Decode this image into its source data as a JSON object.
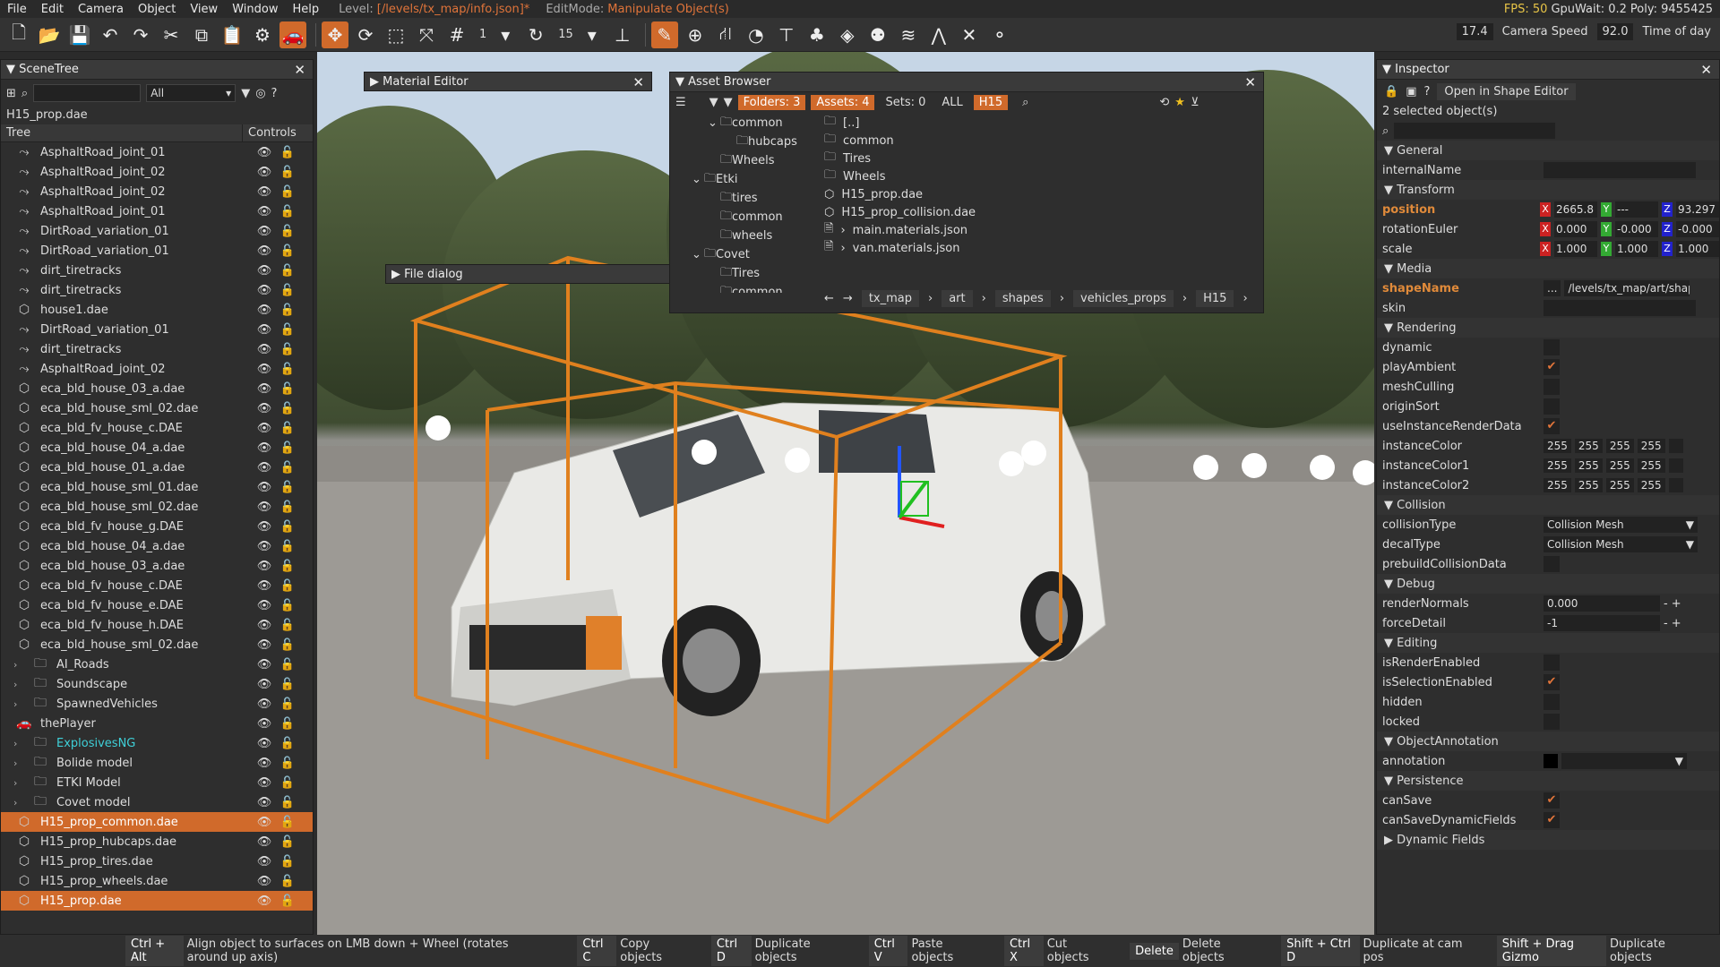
{
  "menu": {
    "items": [
      "File",
      "Edit",
      "Camera",
      "Object",
      "View",
      "Window",
      "Help"
    ],
    "level_label": "Level:",
    "level_value": "[/levels/tx_map/info.json]*",
    "editmode_label": "EditMode:",
    "editmode_value": "Manipulate Object(s)",
    "fps": "FPS: 50",
    "gpuwait": "GpuWait: 0.2",
    "poly": "Poly: 9455425"
  },
  "toolbar": {
    "snap_value": "1",
    "rot_value": "15",
    "fov_value": "17.4",
    "camera_speed_label": "Camera Speed",
    "camera_speed_value": "92.0",
    "time_of_day_label": "Time of day"
  },
  "scenetree": {
    "title": "SceneTree",
    "filter": "All",
    "file": "H15_prop.dae",
    "col_tree": "Tree",
    "col_controls": "Controls",
    "items": [
      {
        "label": "AsphaltRoad_joint_01",
        "icon": "road-icon",
        "sel": false
      },
      {
        "label": "AsphaltRoad_joint_02",
        "icon": "road-icon",
        "sel": false
      },
      {
        "label": "AsphaltRoad_joint_02",
        "icon": "road-icon",
        "sel": false
      },
      {
        "label": "AsphaltRoad_joint_01",
        "icon": "road-icon",
        "sel": false
      },
      {
        "label": "DirtRoad_variation_01",
        "icon": "road-icon",
        "sel": false
      },
      {
        "label": "DirtRoad_variation_01",
        "icon": "road-icon",
        "sel": false
      },
      {
        "label": "dirt_tiretracks",
        "icon": "road-icon",
        "sel": false
      },
      {
        "label": "dirt_tiretracks",
        "icon": "road-icon",
        "sel": false
      },
      {
        "label": "house1.dae",
        "icon": "mesh-icon",
        "sel": false
      },
      {
        "label": "DirtRoad_variation_01",
        "icon": "road-icon",
        "sel": false
      },
      {
        "label": "dirt_tiretracks",
        "icon": "road-icon",
        "sel": false
      },
      {
        "label": "AsphaltRoad_joint_02",
        "icon": "road-icon",
        "sel": false
      },
      {
        "label": "eca_bld_house_03_a.dae",
        "icon": "mesh-icon",
        "sel": false
      },
      {
        "label": "eca_bld_house_sml_02.dae",
        "icon": "mesh-icon",
        "sel": false
      },
      {
        "label": "eca_bld_fv_house_c.DAE",
        "icon": "mesh-icon",
        "sel": false
      },
      {
        "label": "eca_bld_house_04_a.dae",
        "icon": "mesh-icon",
        "sel": false
      },
      {
        "label": "eca_bld_house_01_a.dae",
        "icon": "mesh-icon",
        "sel": false
      },
      {
        "label": "eca_bld_house_sml_01.dae",
        "icon": "mesh-icon",
        "sel": false
      },
      {
        "label": "eca_bld_house_sml_02.dae",
        "icon": "mesh-icon",
        "sel": false
      },
      {
        "label": "eca_bld_fv_house_g.DAE",
        "icon": "mesh-icon",
        "sel": false
      },
      {
        "label": "eca_bld_house_04_a.dae",
        "icon": "mesh-icon",
        "sel": false
      },
      {
        "label": "eca_bld_house_03_a.dae",
        "icon": "mesh-icon",
        "sel": false
      },
      {
        "label": "eca_bld_fv_house_c.DAE",
        "icon": "mesh-icon",
        "sel": false
      },
      {
        "label": "eca_bld_fv_house_e.DAE",
        "icon": "mesh-icon",
        "sel": false
      },
      {
        "label": "eca_bld_fv_house_h.DAE",
        "icon": "mesh-icon",
        "sel": false
      },
      {
        "label": "eca_bld_house_sml_02.dae",
        "icon": "mesh-icon",
        "sel": false
      },
      {
        "label": "AI_Roads",
        "icon": "folder-icon",
        "sel": false,
        "group": true
      },
      {
        "label": "Soundscape",
        "icon": "folder-icon",
        "sel": false,
        "group": true
      },
      {
        "label": "SpawnedVehicles",
        "icon": "folder-icon",
        "sel": false,
        "group": true
      },
      {
        "label": "thePlayer",
        "icon": "car-icon",
        "sel": false
      },
      {
        "label": "ExplosivesNG",
        "icon": "folder-icon",
        "sel": false,
        "group": true,
        "cyan": true
      },
      {
        "label": "Bolide model",
        "icon": "folder-icon",
        "sel": false,
        "group": true
      },
      {
        "label": "ETKI Model",
        "icon": "folder-icon",
        "sel": false,
        "group": true
      },
      {
        "label": "Covet model",
        "icon": "folder-icon",
        "sel": false,
        "group": true
      },
      {
        "label": "H15_prop_common.dae",
        "icon": "mesh-icon",
        "sel": true
      },
      {
        "label": "H15_prop_hubcaps.dae",
        "icon": "mesh-icon",
        "sel": false
      },
      {
        "label": "H15_prop_tires.dae",
        "icon": "mesh-icon",
        "sel": false
      },
      {
        "label": "H15_prop_wheels.dae",
        "icon": "mesh-icon",
        "sel": false
      },
      {
        "label": "H15_prop.dae",
        "icon": "mesh-icon",
        "sel": true
      }
    ]
  },
  "material_editor": {
    "title": "Material Editor"
  },
  "file_dialog": {
    "title": "File dialog"
  },
  "asset_browser": {
    "title": "Asset Browser",
    "folders": "Folders: 3",
    "assets": "Assets: 4",
    "sets": "Sets: 0",
    "all": "ALL",
    "filter": "H15",
    "tree": [
      {
        "label": "common",
        "indent": 2,
        "open": true
      },
      {
        "label": "hubcaps",
        "indent": 3
      },
      {
        "label": "Wheels",
        "indent": 2
      },
      {
        "label": "Etki",
        "indent": 1,
        "open": true
      },
      {
        "label": "tires",
        "indent": 2
      },
      {
        "label": "common",
        "indent": 2
      },
      {
        "label": "wheels",
        "indent": 2
      },
      {
        "label": "Covet",
        "indent": 1,
        "open": true
      },
      {
        "label": "Tires",
        "indent": 2
      },
      {
        "label": "common",
        "indent": 2
      }
    ],
    "files": [
      {
        "label": "[..]",
        "icon": "folder-icon"
      },
      {
        "label": "common",
        "icon": "folder-icon"
      },
      {
        "label": "Tires",
        "icon": "folder-icon"
      },
      {
        "label": "Wheels",
        "icon": "folder-icon"
      },
      {
        "label": "H15_prop.dae",
        "icon": "mesh-icon"
      },
      {
        "label": "H15_prop_collision.dae",
        "icon": "mesh-icon"
      },
      {
        "label": "main.materials.json",
        "icon": "file-icon",
        "expand": true
      },
      {
        "label": "van.materials.json",
        "icon": "file-icon",
        "expand": true
      }
    ],
    "path": [
      "tx_map",
      "art",
      "shapes",
      "vehicles_props",
      "H15"
    ]
  },
  "inspector": {
    "title": "Inspector",
    "open_shape_editor": "Open in Shape Editor",
    "selected": "2 selected object(s)",
    "general": "General",
    "internalName": "internalName",
    "transform": "Transform",
    "position": "position",
    "pos_x": "2665.8",
    "pos_y": "---",
    "pos_z": "93.297",
    "rotationEuler": "rotationEuler",
    "rot_x": "0.000",
    "rot_y": "-0.000",
    "rot_z": "-0.000",
    "scale": "scale",
    "sc_x": "1.000",
    "sc_y": "1.000",
    "sc_z": "1.000",
    "media": "Media",
    "shapeName": "shapeName",
    "shape_btn": "...",
    "shape_value": "/levels/tx_map/art/shap",
    "skin": "skin",
    "rendering": "Rendering",
    "dynamic": "dynamic",
    "playAmbient": "playAmbient",
    "meshCulling": "meshCulling",
    "originSort": "originSort",
    "useInstanceRenderData": "useInstanceRenderData",
    "instanceColor": "instanceColor",
    "instanceColor1": "instanceColor1",
    "instanceColor2": "instanceColor2",
    "c255": "255",
    "collision": "Collision",
    "collisionType": "collisionType",
    "collisionType_value": "Collision Mesh",
    "decalType": "decalType",
    "decalType_value": "Collision Mesh",
    "prebuildCollisionData": "prebuildCollisionData",
    "debug": "Debug",
    "renderNormals": "renderNormals",
    "renderNormals_value": "0.000",
    "forceDetail": "forceDetail",
    "forceDetail_value": "-1",
    "editing": "Editing",
    "isRenderEnabled": "isRenderEnabled",
    "isSelectionEnabled": "isSelectionEnabled",
    "hidden": "hidden",
    "locked": "locked",
    "objectAnnotation": "ObjectAnnotation",
    "annotation": "annotation",
    "persistence": "Persistence",
    "canSave": "canSave",
    "canSaveDynamicFields": "canSaveDynamicFields",
    "dynamicFields": "Dynamic Fields"
  },
  "statusbar": [
    {
      "k": "Ctrl + Alt",
      "d": "Align object to surfaces on LMB down + Wheel (rotates around up axis)"
    },
    {
      "k": "Ctrl C",
      "d": "Copy objects"
    },
    {
      "k": "Ctrl D",
      "d": "Duplicate objects"
    },
    {
      "k": "Ctrl V",
      "d": "Paste objects"
    },
    {
      "k": "Ctrl X",
      "d": "Cut objects"
    },
    {
      "k": "Delete",
      "d": "Delete objects"
    },
    {
      "k": "Shift + Ctrl D",
      "d": "Duplicate at cam pos"
    },
    {
      "k": "Shift + Drag Gizmo",
      "d": "Duplicate objects"
    }
  ],
  "colors": {
    "accent": "#d06a2b",
    "bbox": "#e0801e"
  }
}
